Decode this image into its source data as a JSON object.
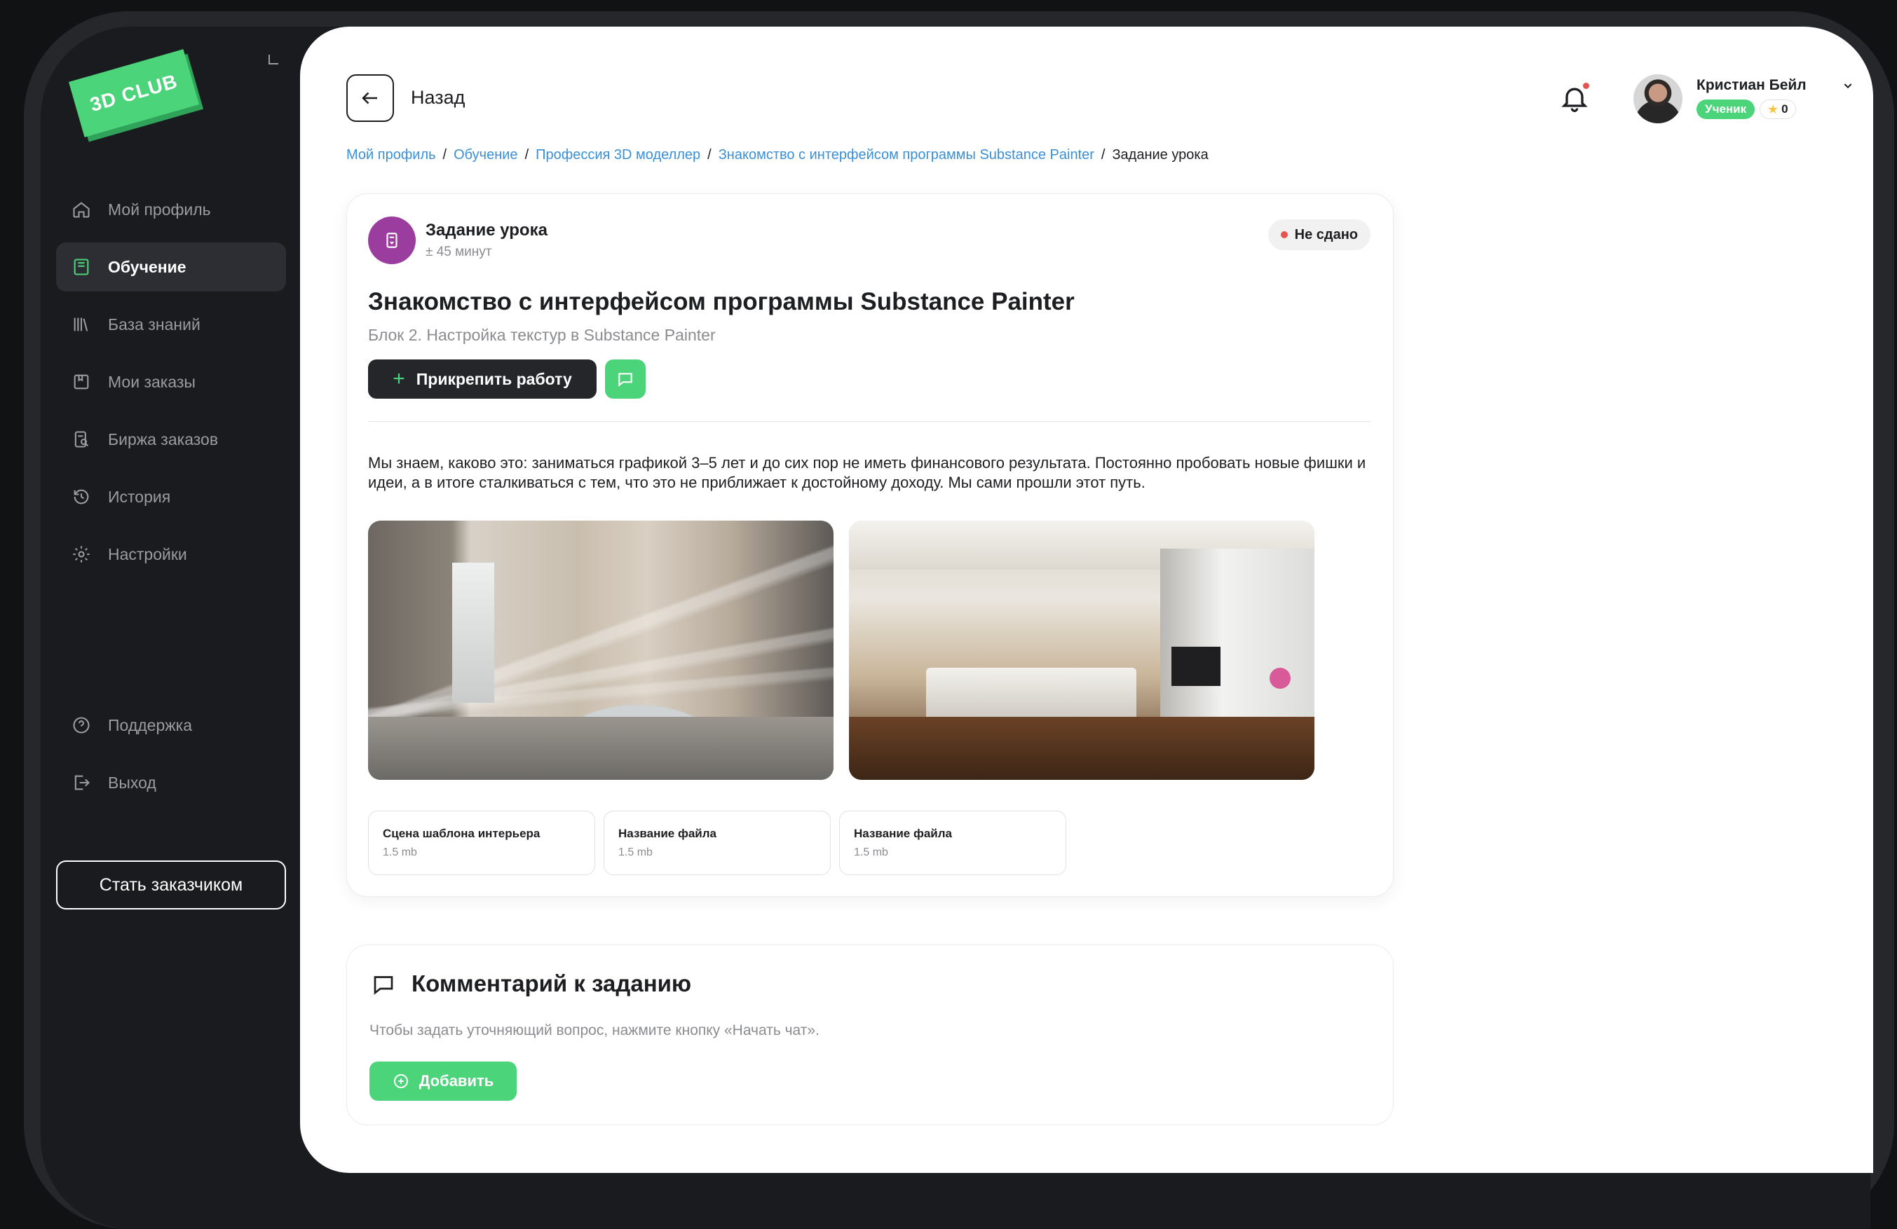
{
  "brand": {
    "logo_text": "3D CLUB",
    "accent": "#4cd47a",
    "dark": "#1d1e22"
  },
  "sidebar": {
    "items": [
      {
        "label": "Мой профиль",
        "icon": "home-icon",
        "active": false
      },
      {
        "label": "Обучение",
        "icon": "book-icon",
        "active": true
      },
      {
        "label": "База знаний",
        "icon": "library-icon",
        "active": false
      },
      {
        "label": "Мои заказы",
        "icon": "orders-icon",
        "active": false
      },
      {
        "label": "Биржа заказов",
        "icon": "exchange-icon",
        "active": false
      },
      {
        "label": "История",
        "icon": "history-icon",
        "active": false
      },
      {
        "label": "Настройки",
        "icon": "gear-icon",
        "active": false
      }
    ],
    "bottom_items": [
      {
        "label": "Поддержка",
        "icon": "help-icon"
      },
      {
        "label": "Выход",
        "icon": "logout-icon"
      }
    ],
    "become_customer_label": "Стать заказчиком"
  },
  "header": {
    "back_label": "Назад",
    "user": {
      "name": "Кристиан Бейл",
      "role": "Ученик",
      "points": "0"
    }
  },
  "breadcrumb": {
    "links": [
      "Мой профиль",
      "Обучение",
      "Профессия 3D моделлер",
      "Знакомство с интерфейсом программы Substance Painter"
    ],
    "current": "Задание урока"
  },
  "task": {
    "label": "Задание урока",
    "duration": "± 45 минут",
    "status": "Не сдано",
    "title": "Знакомство с интерфейсом программы Substance Painter",
    "subtitle": "Блок 2. Настройка текстур в Substance Painter",
    "attach_label": "Прикрепить работу",
    "description": "Мы знаем, каково это: заниматься графикой 3–5 лет и до сих пор не иметь финансового результата. Постоянно пробовать новые фишки и идеи, а в итоге сталкиваться с тем, что это не приближает к достойному доходу. Мы сами прошли этот путь.",
    "files": [
      {
        "name": "Сцена шаблона интерьера",
        "size": "1.5 mb"
      },
      {
        "name": "Название файла",
        "size": "1.5 mb"
      },
      {
        "name": "Название файла",
        "size": "1.5 mb"
      }
    ]
  },
  "comment": {
    "title": "Комментарий к заданию",
    "hint": "Чтобы задать уточняющий вопрос, нажмите кнопку «Начать чат».",
    "add_label": "Добавить"
  }
}
